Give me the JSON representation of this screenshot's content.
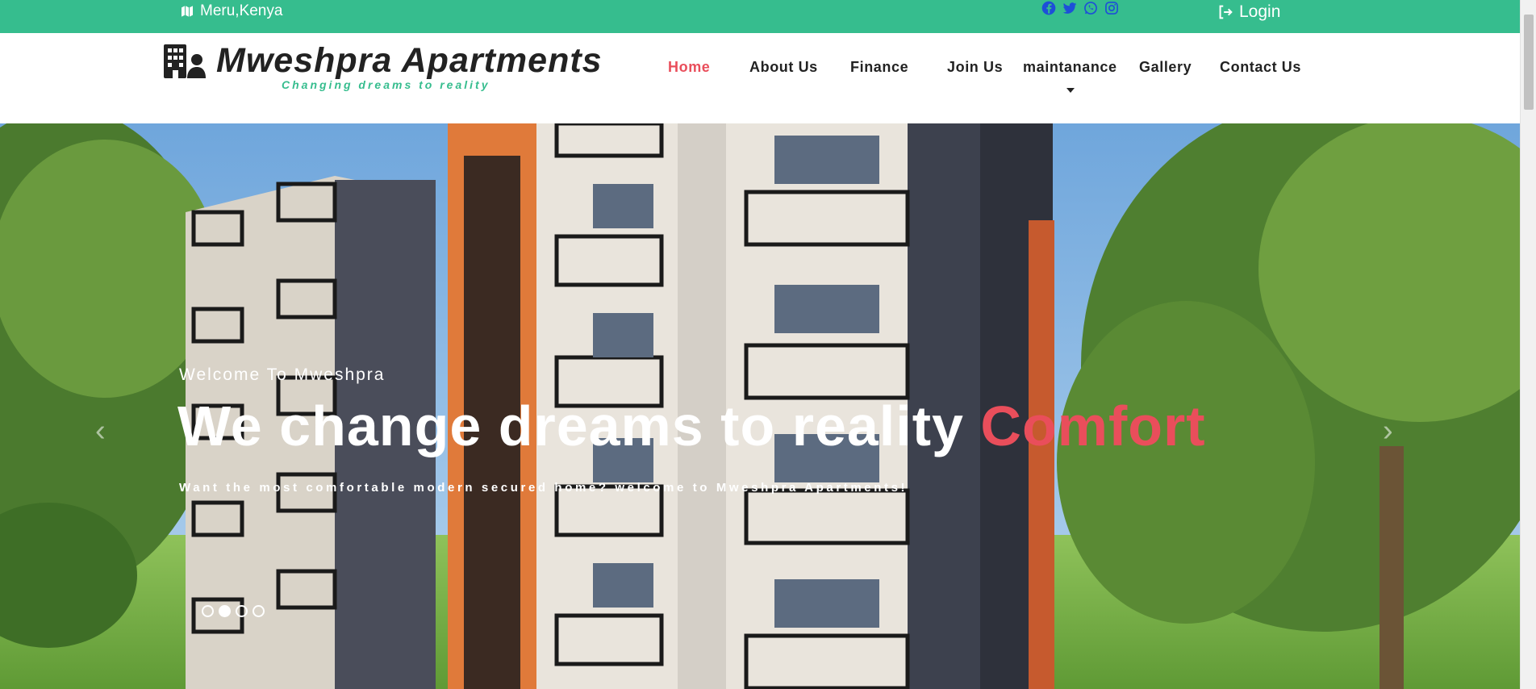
{
  "topbar": {
    "location": "Meru,Kenya",
    "location_icon": "map-icon",
    "social_icons": [
      "facebook-icon",
      "twitter-icon",
      "whatsapp-icon",
      "instagram-icon"
    ],
    "social_color": "#1d4fd8",
    "login_label": "Login",
    "bg_color": "#36bd8e"
  },
  "brand": {
    "title": "Mweshpra Apartments",
    "tagline": "Changing dreams to reality",
    "icon": "building-user-icon"
  },
  "nav": {
    "items": [
      {
        "label": "Home",
        "active": true
      },
      {
        "label": "About Us"
      },
      {
        "label": "Finance"
      },
      {
        "label": "Join Us"
      },
      {
        "label": "maintanance",
        "dropdown": true
      },
      {
        "label": "Gallery"
      },
      {
        "label": "Contact Us"
      }
    ],
    "active_color": "#e94e5b"
  },
  "hero": {
    "welcome": "Welcome To Mweshpra",
    "title_main": "We change dreams to reality ",
    "title_accent": "Comfort",
    "subtitle": "Want the most comfortable modern secured home? welcome to Mweshpra Apartments!",
    "prev_label": "‹",
    "next_label": "›",
    "slide_count": 4,
    "active_slide": 2,
    "accent_color": "#e94e5b"
  }
}
